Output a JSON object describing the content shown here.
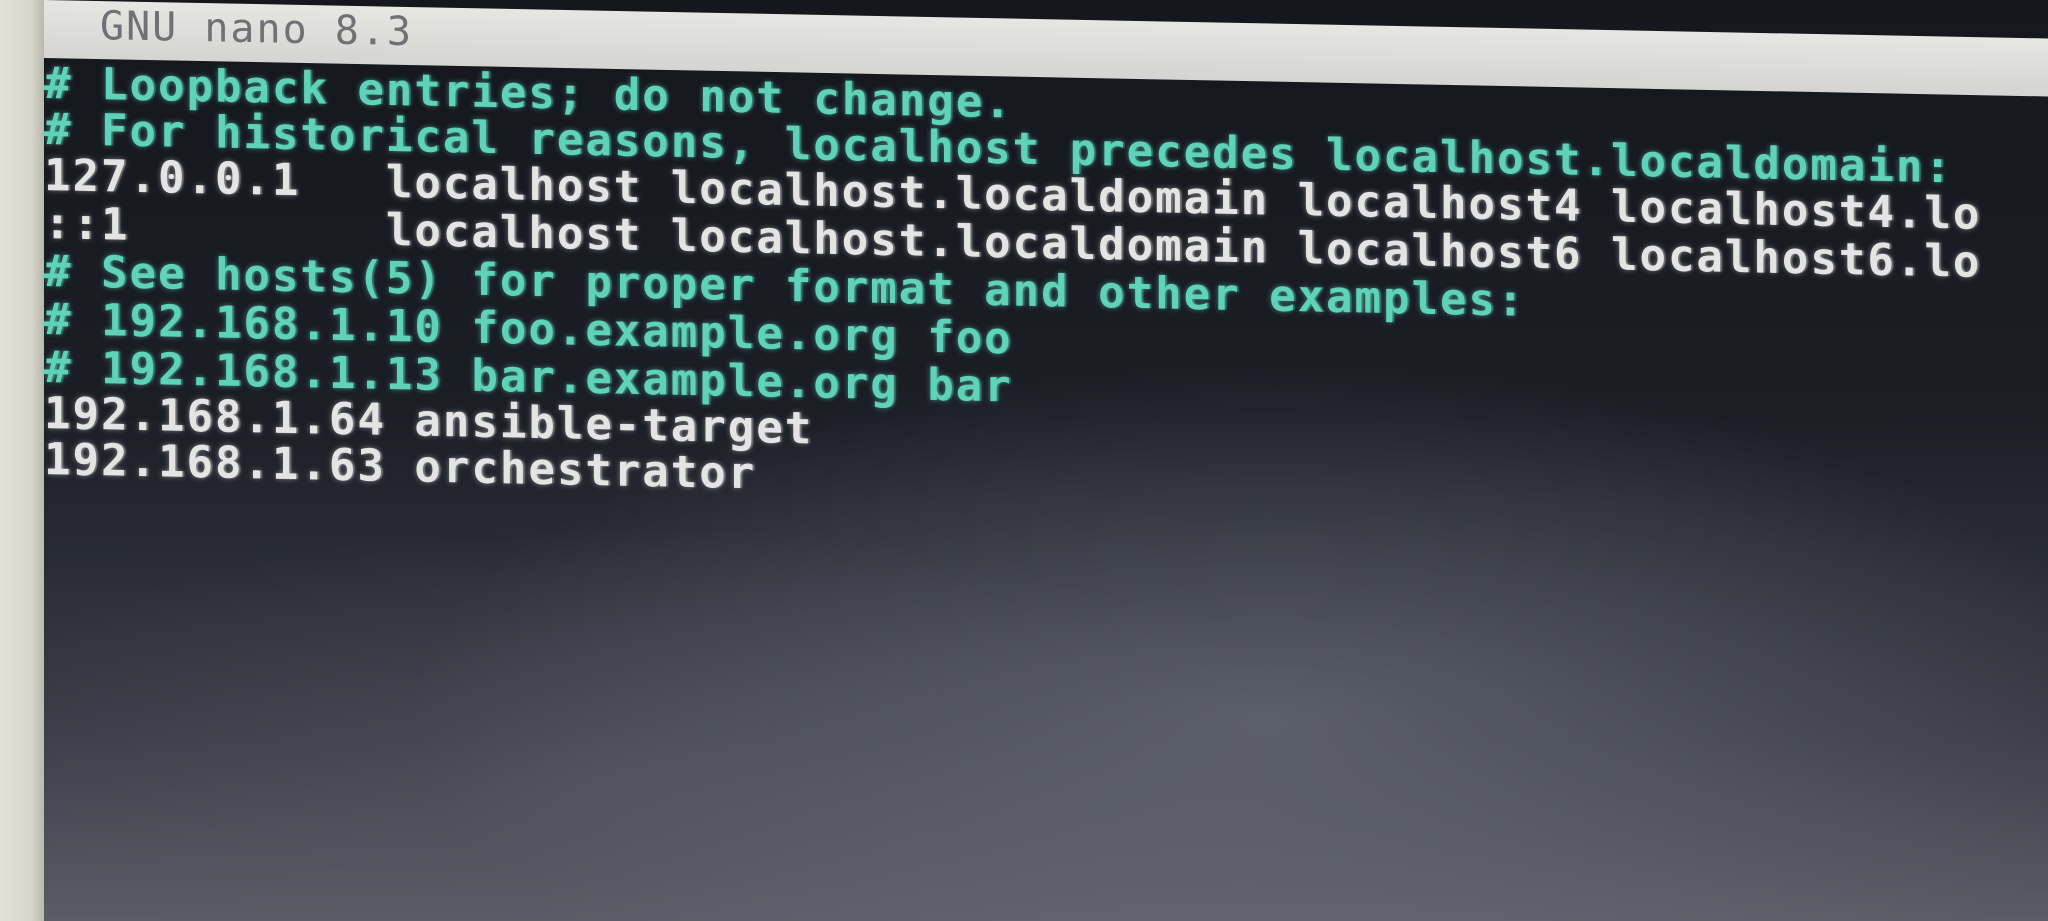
{
  "app": {
    "title": "GNU nano 8.3"
  },
  "editor": {
    "lines": [
      {
        "text": "# Loopback entries; do not change.",
        "kind": "comment"
      },
      {
        "text": "# For historical reasons, localhost precedes localhost.localdomain:",
        "kind": "comment"
      },
      {
        "text": "127.0.0.1   localhost localhost.localdomain localhost4 localhost4.lo",
        "kind": "plain"
      },
      {
        "text": "::1         localhost localhost.localdomain localhost6 localhost6.lo",
        "kind": "plain"
      },
      {
        "text": "# See hosts(5) for proper format and other examples:",
        "kind": "comment"
      },
      {
        "text": "# 192.168.1.10 foo.example.org foo",
        "kind": "comment"
      },
      {
        "text": "# 192.168.1.13 bar.example.org bar",
        "kind": "comment"
      },
      {
        "text": "192.168.1.64 ansible-target",
        "kind": "plain"
      },
      {
        "text": "192.168.1.63 orchestrator",
        "kind": "plain"
      }
    ]
  },
  "colors": {
    "comment": "#5fd3b8",
    "text": "#e4e4e4",
    "background": "#1b1e25",
    "titlebar": "#d4d4d2"
  }
}
